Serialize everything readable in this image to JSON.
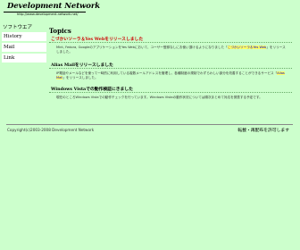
{
  "logo": {
    "title": "Development Network",
    "url": "http://www.development-network.net/"
  },
  "sidebar": {
    "heading": "ソフトウエア",
    "items": [
      {
        "label": "History"
      },
      {
        "label": "Mail"
      },
      {
        "label": "Link"
      }
    ]
  },
  "main": {
    "title": "Topics",
    "articles": [
      {
        "heading": "こづかいソーラ＆Yes Webをリリースしました",
        "body_before": "Mint, Fedora, GoogleのアプリケーションをYes Webにおいて、ユーザー登録なしにお使い頂けるようになりました「",
        "body_link": "こづかいソーラ＆Yes Web",
        "body_after": "」をリリースしました。"
      },
      {
        "heading": "Alias Mailをリリースしました",
        "body_before": "IP電話やメールなどを使って一時的に利用している複数メールアドレスを管理し、各種制度の規制でわずらわしい部分を改善することができるサービス「",
        "body_link": "Alias Mail",
        "body_after": "」をリリースしました。"
      },
      {
        "heading": "Windows Vistaでの動作検証にきました",
        "body_before": "現在のところWindows Vistaでの動作チェックを行っています。Windows Vistaの動作状況については順次まとめて対応を発表する予定です。",
        "body_link": "",
        "body_after": ""
      }
    ]
  },
  "footer": {
    "copyright": "Copyright(c)2003-2008 Development Network",
    "contact": "転載・再配布を許可します"
  },
  "colors": {
    "background": "#ccffcc",
    "nav_item_bg": "#ffffff",
    "heading_red": "#cc0000",
    "link_highlight": "#ffff66"
  }
}
